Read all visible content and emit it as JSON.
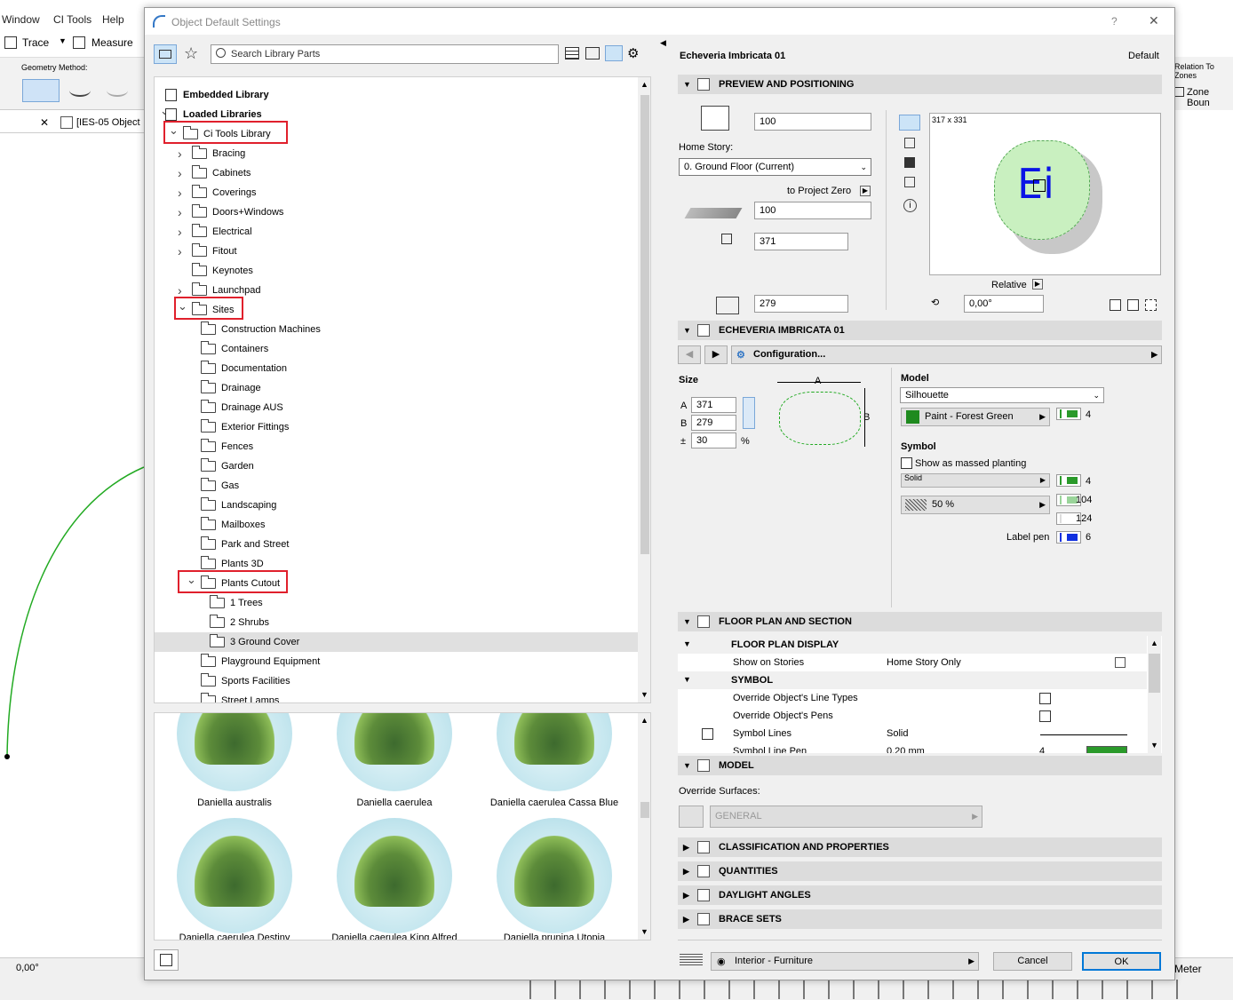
{
  "background": {
    "menu": [
      "Window",
      "CI Tools",
      "Help"
    ],
    "toolbar": {
      "trace": "Trace",
      "measure": "Measure"
    },
    "geometry_method": "Geometry Method:",
    "tab": "[IES-05 Object",
    "right_labels": {
      "relation": "Relation To Zones",
      "zone_bound": "Zone Boun"
    },
    "angle": "0,00°",
    "meter": "Meter"
  },
  "dialog": {
    "title": "Object Default Settings",
    "help": "?",
    "close": "✕",
    "search_placeholder": "Search Library Parts",
    "tree": {
      "embedded": "Embedded Library",
      "loaded": "Loaded Libraries",
      "ci_tools": "Ci Tools Library",
      "level1": [
        "Bracing",
        "Cabinets",
        "Coverings",
        "Doors+Windows",
        "Electrical",
        "Fitout",
        "Keynotes",
        "Launchpad"
      ],
      "sites": "Sites",
      "level2": [
        "Construction Machines",
        "Containers",
        "Documentation",
        "Drainage",
        "Drainage AUS",
        "Exterior Fittings",
        "Fences",
        "Garden",
        "Gas",
        "Landscaping",
        "Mailboxes",
        "Park and Street",
        "Plants 3D"
      ],
      "plants_cutout": "Plants Cutout",
      "level3": [
        "1 Trees",
        "2 Shrubs",
        "3 Ground Cover"
      ],
      "level2b": [
        "Playground Equipment",
        "Sports Facilities",
        "Street Lamps"
      ]
    },
    "thumbnails": [
      "Daniella australis",
      "Daniella caerulea",
      "Daniella caerulea Cassa Blue",
      "Daniella caerulea Destiny",
      "Daniella caerulea King Alfred",
      "Daniella prunina Utopia"
    ],
    "right": {
      "object_name": "Echeveria Imbricata 01",
      "default": "Default",
      "preview_section": "PREVIEW AND POSITIONING",
      "elev_value": "100",
      "home_story_label": "Home Story:",
      "home_story_value": "0. Ground Floor (Current)",
      "to_project_zero": "to Project Zero",
      "zero_value": "100",
      "width_value": "371",
      "height_value": "279",
      "preview_size": "317 x 331",
      "preview_text": "Ei",
      "relative": "Relative",
      "angle": "0,00°",
      "object_section": "ECHEVERIA IMBRICATA 01",
      "configuration": "Configuration...",
      "size_label": "Size",
      "a_label": "A",
      "a_value": "371",
      "b_label": "B",
      "b_value": "279",
      "pm_label": "±",
      "pm_value": "30",
      "percent": "%",
      "dim_a": "A",
      "dim_b": "B",
      "model_label": "Model",
      "model_value": "Silhouette",
      "paint": "Paint - Forest Green",
      "paint_pen": "4",
      "symbol_label": "Symbol",
      "massed": "Show as massed planting",
      "solid": "Solid",
      "solid_pen": "4",
      "fill_pct": "50 %",
      "fill_pen1": "104",
      "fill_pen2": "124",
      "label_pen": "Label pen",
      "label_pen_val": "6",
      "floor_section": "FLOOR PLAN AND SECTION",
      "floor_display": "FLOOR PLAN DISPLAY",
      "show_on_stories": "Show on Stories",
      "home_story_only": "Home Story Only",
      "symbol_group": "SYMBOL",
      "override_lines": "Override Object's Line Types",
      "override_pens": "Override Object's Pens",
      "symbol_lines": "Symbol Lines",
      "symbol_lines_val": "Solid",
      "symbol_line_pen": "Symbol Line Pen",
      "symbol_line_pen_val": "0,20 mm",
      "symbol_line_pen_num": "4",
      "model_section": "MODEL",
      "override_surfaces": "Override Surfaces:",
      "general": "GENERAL",
      "classification": "CLASSIFICATION AND PROPERTIES",
      "quantities": "QUANTITIES",
      "daylight": "DAYLIGHT ANGLES",
      "brace": "BRACE SETS",
      "layer": "Interior - Furniture",
      "cancel": "Cancel",
      "ok": "OK"
    }
  },
  "colors": {
    "accent": "#0078d7",
    "red_highlight": "#e0202c",
    "green": "#2a9a2a",
    "blue_pen": "#1030e0"
  }
}
